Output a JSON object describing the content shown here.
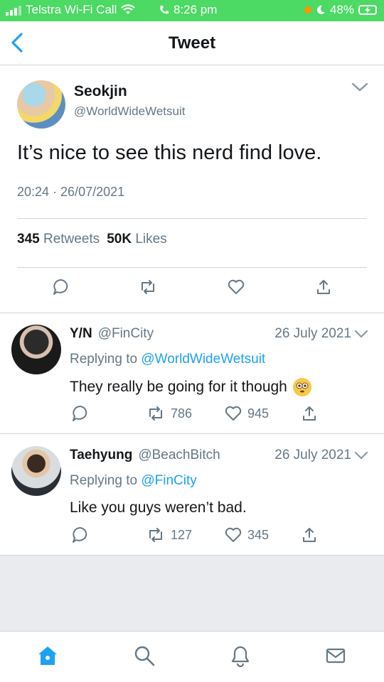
{
  "status_bar": {
    "carrier": "Telstra Wi-Fi Call",
    "time": "8:26 pm",
    "battery": "48%"
  },
  "header": {
    "title": "Tweet",
    "back_icon": "chevron-left-icon"
  },
  "main_tweet": {
    "name": "Seokjin",
    "handle": "@WorldWideWetsuit",
    "text": "It’s nice to see this nerd find love.",
    "timestamp": "20:24 · 26/07/2021",
    "retweets_count": "345",
    "retweets_label": "Retweets",
    "likes_count": "50K",
    "likes_label": "Likes"
  },
  "replies": [
    {
      "name": "Y/N",
      "handle": "@FinCity",
      "date": "26 July 2021",
      "replying_prefix": "Replying to",
      "replying_to": "@WorldWideWetsuit",
      "text": "They really be going for it though",
      "retweets": "786",
      "likes": "945"
    },
    {
      "name": "Taehyung",
      "handle": "@BeachBitch",
      "date": "26 July 2021",
      "replying_prefix": "Replying to",
      "replying_to": "@FinCity",
      "text": "Like you guys weren’t bad.",
      "retweets": "127",
      "likes": "345"
    }
  ],
  "colors": {
    "status_bar": "#4cd964",
    "accent": "#1da1f2",
    "muted_text": "#657786"
  }
}
